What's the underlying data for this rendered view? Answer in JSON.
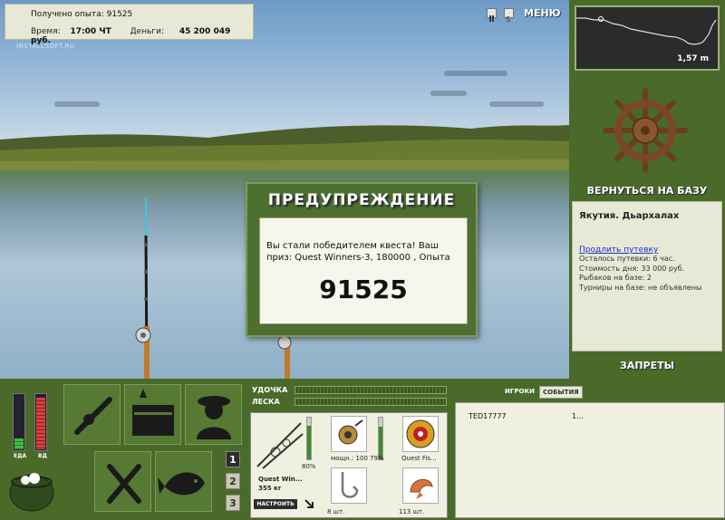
{
  "info": {
    "exp_label": "Получено опыта:",
    "exp_value": "91525",
    "time_label": "Время:",
    "time_value": "17:00 ЧТ",
    "money_label": "Деньги:",
    "money_value": "45 200 049 руб."
  },
  "watermark": "INSTALLSOFT.RU",
  "top_icons": [
    "pause-icon",
    "sound-icon"
  ],
  "menu_label": "МЕНЮ",
  "depth": {
    "value": "1,57 m"
  },
  "back_to_base": "ВЕРНУТЬСЯ НА БАЗУ",
  "location": {
    "title": "Якутия. Дьархалах",
    "link": "Продлить путевку",
    "lines": [
      "Осталось путевки: 6 час.",
      "Стоимость дня: 33 000 руб.",
      "Рыбаков на базе: 2",
      "Турниры на базе: не объявлены"
    ]
  },
  "bans_label": "ЗАПРЕТЫ",
  "dialog": {
    "title": "ПРЕДУПРЕЖДЕНИЕ",
    "text": "Вы стали победителем квеста! Ваш приз: Quest Winners-3, 180000 , Опыта",
    "number": "91525"
  },
  "meters": {
    "food_label": "ЕДА",
    "drink_label": "ВД",
    "food_level": 0.2,
    "drink_level": 0.95
  },
  "nav_numbers": [
    "1",
    "2",
    "3"
  ],
  "tackle_bars": {
    "rod_label": "УДОЧКА",
    "line_label": "ЛЕСКА"
  },
  "tackle": {
    "rod_name": "Quest Win...",
    "rod_weight": "355 кг",
    "rod_percent": "80%",
    "reel_caption": "мощн.: 100",
    "reel_percent": "79%",
    "line_caption": "Quest Fis...",
    "hook_count": "8 шт.",
    "bait_count": "113 шт.",
    "setup_button": "НАСТРОИТЬ",
    "rod_level": 0.8,
    "reel_level": 0.79
  },
  "players": {
    "tab_players": "ИГРОКИ",
    "tab_events": "СОБЫТИЯ",
    "rows": [
      {
        "name": "TED17777",
        "value": "1..."
      }
    ]
  },
  "colors": {
    "panel_green": "#4a6a2a",
    "panel_light": "#e8e8d6",
    "link_blue": "#1a2fd0"
  }
}
